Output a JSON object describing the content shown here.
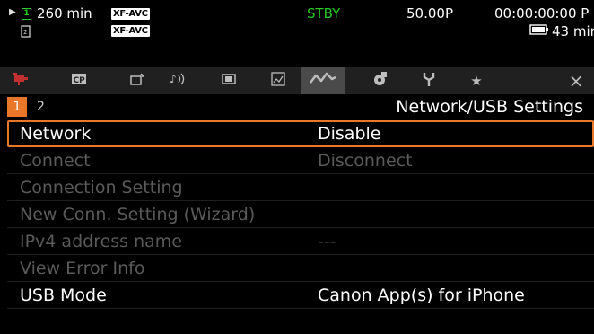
{
  "status": {
    "play_marker": "▶",
    "slot_primary": "1",
    "record_time": "260 min",
    "codec_1": "XF-AVC",
    "codec_2": "XF-AVC",
    "mode": "STBY",
    "frame_rate": "50.00P",
    "timecode": "00:00:00:00 P",
    "battery_time": "43 min",
    "colors": {
      "standby": "#26c826",
      "accent": "#e8772a"
    }
  },
  "tabs": [
    {
      "icon": "camera-icon",
      "glyph": "▀"
    },
    {
      "icon": "custom-picture-icon",
      "glyph": "CP"
    },
    {
      "icon": "camera-setup-icon",
      "glyph": "⌗"
    },
    {
      "icon": "audio-icon",
      "glyph": "♪))"
    },
    {
      "icon": "display-icon",
      "glyph": "▣"
    },
    {
      "icon": "assist-icon",
      "glyph": "▥"
    },
    {
      "icon": "network-icon",
      "glyph": "∿"
    },
    {
      "icon": "recording-media-icon",
      "glyph": "◉"
    },
    {
      "icon": "system-icon",
      "glyph": "Y"
    },
    {
      "icon": "my-menu-icon",
      "glyph": "★"
    },
    {
      "icon": "close-icon",
      "glyph": "×"
    }
  ],
  "page": {
    "current": "1",
    "other": "2",
    "title": "Network/USB Settings"
  },
  "menu_items": [
    {
      "label": "Network",
      "value": "Disable"
    },
    {
      "label": "Connect",
      "value": "Disconnect"
    },
    {
      "label": "Connection Setting",
      "value": ""
    },
    {
      "label": "New Conn. Setting (Wizard)",
      "value": ""
    },
    {
      "label": "IPv4 address name",
      "value": "---"
    },
    {
      "label": "View Error Info",
      "value": ""
    },
    {
      "label": "USB Mode",
      "value": "Canon App(s) for iPhone"
    }
  ]
}
